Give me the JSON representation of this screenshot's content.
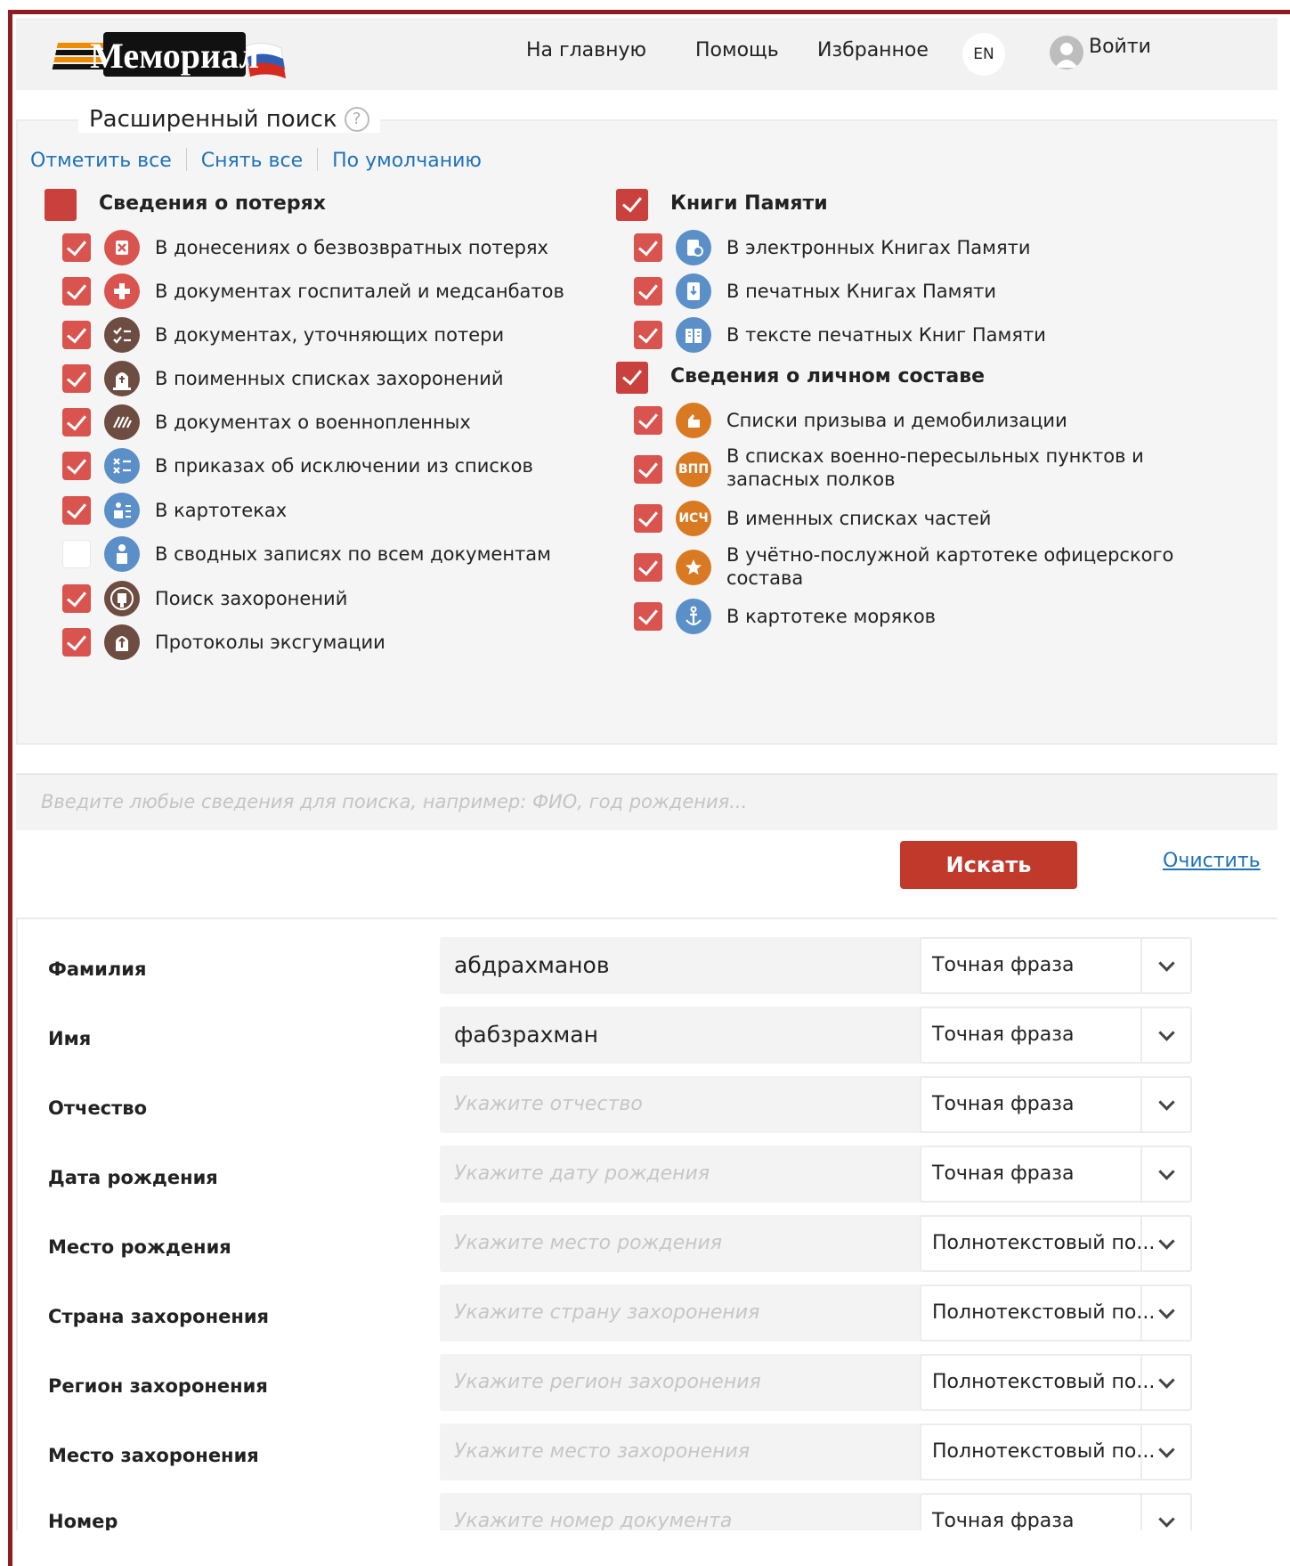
{
  "header": {
    "logo_text": "Мемориал",
    "nav": [
      "На главную",
      "Помощь",
      "Избранное"
    ],
    "lang": "EN",
    "login": "Войти"
  },
  "advanced": {
    "title": "Расширенный поиск",
    "help": "?",
    "links": [
      "Отметить все",
      "Снять все",
      "По умолчанию"
    ],
    "group_losses": "Сведения о потерях",
    "group_books": "Книги Памяти",
    "group_personnel": "Сведения о личном составе",
    "losses": [
      {
        "label": "В донесениях о безвозвратных потерях",
        "checked": true
      },
      {
        "label": "В документах госпиталей и медсанбатов",
        "checked": true
      },
      {
        "label": "В документах, уточняющих потери",
        "checked": true
      },
      {
        "label": "В поименных списках захоронений",
        "checked": true
      },
      {
        "label": "В документах о военнопленных",
        "checked": true
      },
      {
        "label": "В приказах об исключении из списков",
        "checked": true
      },
      {
        "label": "В картотеках",
        "checked": true
      },
      {
        "label": "В сводных записях по всем документам",
        "checked": false
      },
      {
        "label": "Поиск захоронений",
        "checked": true
      },
      {
        "label": "Протоколы эксгумации",
        "checked": true
      }
    ],
    "books": [
      {
        "label": "В электронных Книгах Памяти",
        "checked": true
      },
      {
        "label": "В печатных Книгах Памяти",
        "checked": true
      },
      {
        "label": "В тексте печатных Книг Памяти",
        "checked": true
      }
    ],
    "personnel": [
      {
        "label": "Списки призыва и демобилизации",
        "checked": true
      },
      {
        "label_1": "В списках военно-пересыльных пунктов и",
        "label_2": "запасных полков",
        "checked": true,
        "icon_text": "ВПП"
      },
      {
        "label": "В именных списках частей",
        "checked": true,
        "icon_text": "ИСЧ"
      },
      {
        "label_1": "В учётно-послужной картотеке офицерского",
        "label_2": "состава",
        "checked": true
      },
      {
        "label": "В картотеке моряков",
        "checked": true
      }
    ]
  },
  "query": {
    "placeholder": "Введите любые сведения для поиска, например: ФИО, год рождения..."
  },
  "actions": {
    "search": "Искать",
    "clear": "Очистить"
  },
  "fields": [
    {
      "label": "Фамилия",
      "value": "абдрахманов",
      "placeholder": "",
      "mode": "Точная фраза"
    },
    {
      "label": "Имя",
      "value": "фабзрахман",
      "placeholder": "",
      "mode": "Точная фраза"
    },
    {
      "label": "Отчество",
      "value": "",
      "placeholder": "Укажите отчество",
      "mode": "Точная фраза"
    },
    {
      "label": "Дата рождения",
      "value": "",
      "placeholder": "Укажите дату рождения",
      "mode": "Точная фраза"
    },
    {
      "label": "Место рождения",
      "value": "",
      "placeholder": "Укажите место рождения",
      "mode": "Полнотекстовый по..."
    },
    {
      "label": "Страна захоронения",
      "value": "",
      "placeholder": "Укажите страну захоронения",
      "mode": "Полнотекстовый по..."
    },
    {
      "label": "Регион захоронения",
      "value": "",
      "placeholder": "Укажите регион захоронения",
      "mode": "Полнотекстовый по..."
    },
    {
      "label": "Место захоронения",
      "value": "",
      "placeholder": "Укажите место захоронения",
      "mode": "Полнотекстовый по..."
    },
    {
      "label": "Номер",
      "value": "",
      "placeholder": "Укажите номер документа",
      "mode": "Точная фраза"
    }
  ],
  "colors": {
    "brand_red": "#c0392b",
    "checkbox_red": "#d9534f",
    "link_blue": "#1f73b7",
    "icon_red": "#d9534f",
    "icon_brown": "#6d4c41",
    "icon_blue": "#5b8fc7",
    "icon_orange": "#d97a22"
  }
}
